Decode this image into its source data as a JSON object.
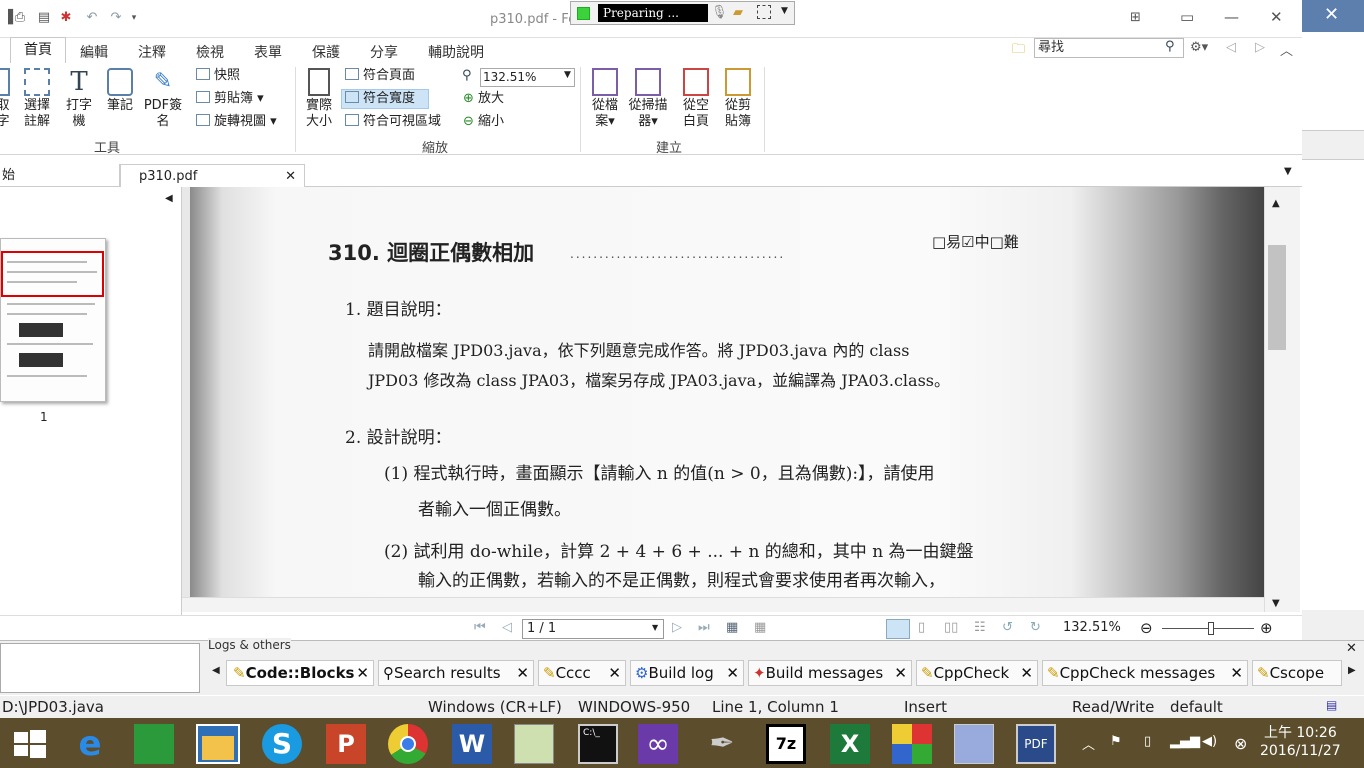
{
  "foxit": {
    "window_title": "p310.pdf - Fo",
    "recording_status": "Preparing ...",
    "menu": [
      "首頁",
      "編輯",
      "注釋",
      "檢視",
      "表單",
      "保護",
      "分享",
      "輔助說明"
    ],
    "search_placeholder": "尋找",
    "ribbon": {
      "tools": {
        "items": [
          "取字",
          "選擇註解",
          "打字機",
          "筆記",
          "PDF簽名"
        ],
        "small": [
          "快照",
          "剪貼簿",
          "旋轉視圖"
        ],
        "group_label": "工具"
      },
      "zoom": {
        "actual_size": "實際大小",
        "small": [
          "符合頁面",
          "符合寬度",
          "符合可視區域"
        ],
        "zoom_value": "132.51%",
        "zoom_in": "放大",
        "zoom_out": "縮小",
        "group_label": "縮放"
      },
      "create": {
        "items": [
          "從檔案",
          "從掃描器",
          "從空白頁",
          "從剪貼簿"
        ],
        "group_label": "建立"
      }
    },
    "doc_tabs": [
      "始",
      "p310.pdf"
    ],
    "thumbnail_label": "1",
    "page_content": {
      "title": "310. 迴圈正偶數相加",
      "difficulty": "□易☑中□難",
      "section1": "1. 題目說明：",
      "para1_line1": "請開啟檔案 JPD03.java，依下列題意完成作答。將 JPD03.java 內的 class",
      "para1_line2": "JPD03 修改為 class JPA03，檔案另存成 JPA03.java，並編譯為 JPA03.class。",
      "section2": "2. 設計說明：",
      "item1_line1": "(1) 程式執行時，畫面顯示【請輸入 n 的值(n > 0，且為偶數):】，請使用",
      "item1_line2": "者輸入一個正偶數。",
      "item2_line1": "(2) 試利用 do-while，計算 2 + 4 + 6 + ... + n 的總和，其中 n 為一由鍵盤",
      "item2_line2": "輸入的正偶數，若輸入的不是正偶數，則程式會要求使用者再次輸入，"
    },
    "page_nav": "1 / 1",
    "status_zoom": "132.51%"
  },
  "codeblocks": {
    "logs_title": "Logs & others",
    "log_tabs": [
      "Code::Blocks",
      "Search results",
      "Cccc",
      "Build log",
      "Build messages",
      "CppCheck",
      "CppCheck messages",
      "Cscope"
    ],
    "status": {
      "file": "D:\\JPD03.java",
      "eol": "Windows (CR+LF)",
      "encoding": "WINDOWS-950",
      "position": "Line 1, Column 1",
      "mode": "Insert",
      "access": "Read/Write",
      "profile": "default"
    }
  },
  "taskbar": {
    "time": "上午 10:26",
    "date": "2016/11/27"
  }
}
